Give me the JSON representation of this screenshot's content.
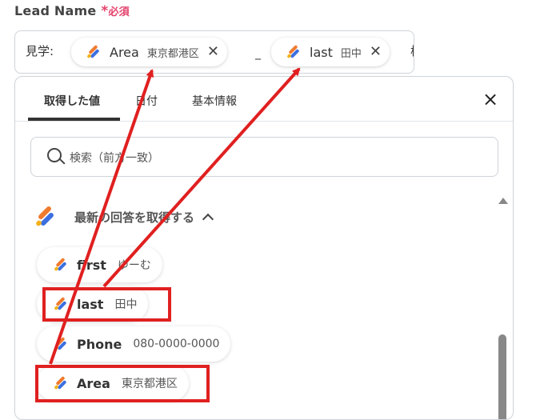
{
  "field": {
    "label": "Lead Name",
    "required_mark": "*",
    "required_text": "必須"
  },
  "value_box": {
    "prefix": "見学:",
    "chips": [
      {
        "key": "Area",
        "value": "東京都港区"
      },
      {
        "key": "last",
        "value": "田中"
      }
    ],
    "separator": "_",
    "trailing": "様"
  },
  "panel": {
    "tabs": [
      {
        "label": "取得した値",
        "active": true
      },
      {
        "label": "日付",
        "active": false
      },
      {
        "label": "基本情報",
        "active": false
      }
    ],
    "close_icon": "×",
    "search_placeholder": "検索（前方一致）",
    "section_title": "最新の回答を取得する",
    "items": [
      {
        "key": "first",
        "value": "ゆーむ"
      },
      {
        "key": "last",
        "value": "田中"
      },
      {
        "key": "Phone",
        "value": "080-0000-0000"
      },
      {
        "key": "Area",
        "value": "東京都港区"
      }
    ]
  },
  "colors": {
    "required": "#e4416b",
    "annotation": "#e02020",
    "logo_orange": "#f07a2d",
    "logo_blue": "#3b6fe0",
    "logo_yellow": "#f2b21b"
  }
}
